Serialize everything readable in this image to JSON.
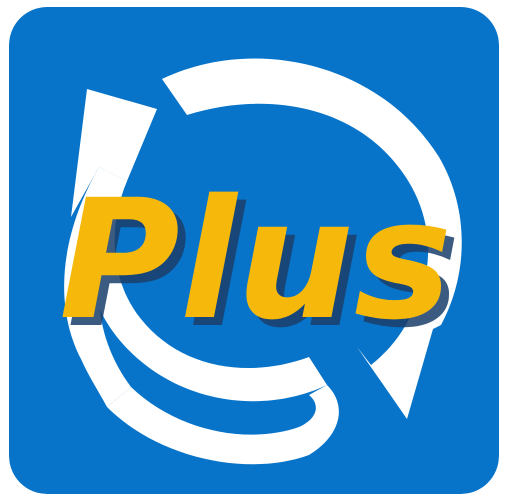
{
  "app_icon": {
    "label": "Plus",
    "icon_name": "refresh-arrows-icon",
    "colors": {
      "background": "#0774c9",
      "arrows": "#ffffff",
      "text": "#f6b90b",
      "text_shadow": "#1b3f6a"
    }
  }
}
